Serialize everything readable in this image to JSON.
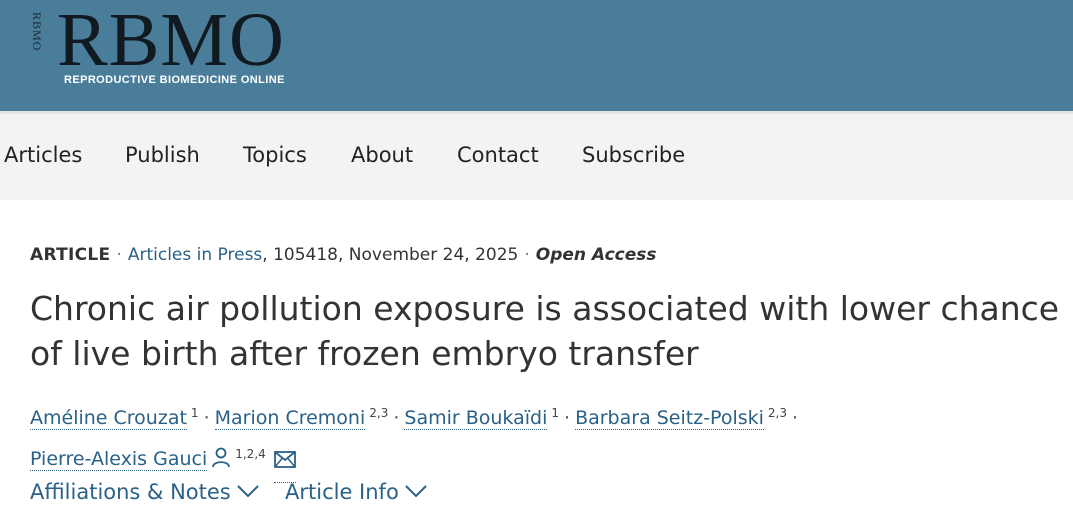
{
  "header": {
    "logo_vertical": "RBMO",
    "logo_text": "RBMO",
    "logo_subtitle": "REPRODUCTIVE BIOMEDICINE ONLINE",
    "background_color": "#4a7d9a"
  },
  "nav": {
    "items": [
      {
        "label": "Articles"
      },
      {
        "label": "Publish"
      },
      {
        "label": "Topics"
      },
      {
        "label": "About"
      },
      {
        "label": "Contact"
      },
      {
        "label": "Subscribe"
      }
    ]
  },
  "article": {
    "type": "ARTICLE",
    "section_link": "Articles in Press",
    "details": ", 105418, November 24, 2025",
    "access": "Open Access",
    "title": "Chronic air pollution exposure is associated with lower chance of live birth after frozen embryo transfer",
    "authors": [
      {
        "name": "Améline Crouzat",
        "sup": "1"
      },
      {
        "name": "Marion Cremoni",
        "sup": "2,3"
      },
      {
        "name": "Samir Boukaïdi",
        "sup": "1"
      },
      {
        "name": "Barbara Seitz-Polski",
        "sup": "2,3"
      },
      {
        "name": "Pierre-Alexis Gauci",
        "sup": "1,2,4",
        "icons": [
          "person-icon",
          "envelope-icon"
        ]
      }
    ]
  },
  "expanders": {
    "affiliations": "Affiliations & Notes",
    "article_info": "Article Info"
  },
  "colors": {
    "link": "#2a6187",
    "text": "#333333"
  }
}
